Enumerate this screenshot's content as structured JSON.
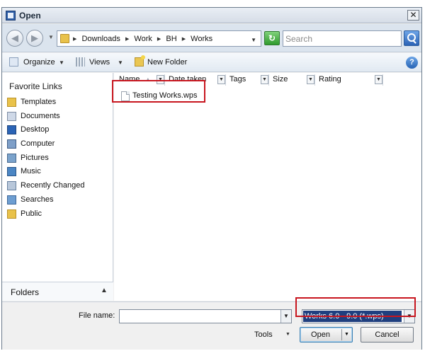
{
  "window": {
    "title": "Open",
    "close_glyph": "✕"
  },
  "nav": {
    "back_glyph": "◀",
    "forward_glyph": "▶",
    "dropdown_glyph": "▼",
    "breadcrumb": [
      "Downloads",
      "Work",
      "BH",
      "Works"
    ],
    "separator": "▶",
    "search_placeholder": "Search",
    "refresh_glyph": "↻"
  },
  "toolbar": {
    "organize": "Organize",
    "views": "Views",
    "new_folder": "New Folder",
    "arrow": "▼",
    "help": "?"
  },
  "sidebar": {
    "title": "Favorite Links",
    "items": [
      {
        "label": "Templates",
        "icon": "folder-icon"
      },
      {
        "label": "Documents",
        "icon": "documents-icon"
      },
      {
        "label": "Desktop",
        "icon": "desktop-icon"
      },
      {
        "label": "Computer",
        "icon": "computer-icon"
      },
      {
        "label": "Pictures",
        "icon": "pictures-icon"
      },
      {
        "label": "Music",
        "icon": "music-icon"
      },
      {
        "label": "Recently Changed",
        "icon": "recent-icon"
      },
      {
        "label": "Searches",
        "icon": "searches-icon"
      },
      {
        "label": "Public",
        "icon": "folder-icon"
      }
    ],
    "folders_label": "Folders",
    "folders_chevron": "▲"
  },
  "columns": {
    "name": "Name",
    "date_taken": "Date taken",
    "tags": "Tags",
    "size": "Size",
    "rating": "Rating",
    "dropdown_glyph": "▼",
    "sort_glyph": "▲"
  },
  "files": [
    {
      "name": "Testing Works.wps"
    }
  ],
  "bottom": {
    "file_name_label": "File name:",
    "file_name_value": "",
    "file_type_value": "Works 6.0 - 9.0 (*.wps)",
    "dropdown_glyph": "▼",
    "tools": "Tools",
    "open": "Open",
    "cancel": "Cancel"
  },
  "colors": {
    "highlight_box": "#c8161f",
    "selection": "#1f3f7f"
  }
}
